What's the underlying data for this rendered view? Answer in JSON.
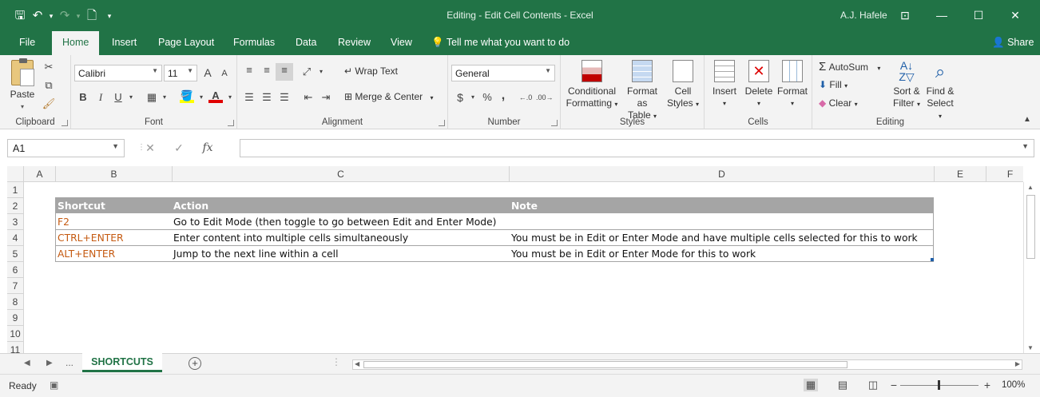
{
  "window": {
    "title": "Editing - Edit Cell Contents  -  Excel",
    "user": "A.J. Hafele",
    "qat": {
      "save": "🖫",
      "undo": "↶",
      "undo_drop": "▾",
      "redo": "↷",
      "redo_drop": "▾",
      "preview": "🗋",
      "customize": "▾"
    },
    "controls": {
      "ribbon_options": "⊡",
      "minimize": "—",
      "maximize": "☐",
      "close": "✕"
    }
  },
  "tabs": [
    {
      "label": "File"
    },
    {
      "label": "Home"
    },
    {
      "label": "Insert"
    },
    {
      "label": "Page Layout"
    },
    {
      "label": "Formulas"
    },
    {
      "label": "Data"
    },
    {
      "label": "Review"
    },
    {
      "label": "View"
    }
  ],
  "tell_me": "Tell me what you want to do",
  "share": "Share",
  "ribbon": {
    "clipboard": {
      "label": "Clipboard",
      "paste": "Paste"
    },
    "font": {
      "label": "Font",
      "family": "Calibri",
      "size": "11",
      "bold": "B",
      "italic": "I",
      "underline": "U",
      "grow": "A",
      "shrink": "A"
    },
    "alignment": {
      "label": "Alignment",
      "wrap": "Wrap Text",
      "merge": "Merge & Center"
    },
    "number": {
      "label": "Number",
      "format": "General",
      "currency": "$",
      "percent": "%",
      "comma": ","
    },
    "styles": {
      "label": "Styles",
      "conditional_1": "Conditional",
      "conditional_2": "Formatting",
      "table_1": "Format as",
      "table_2": "Table",
      "cell_1": "Cell",
      "cell_2": "Styles"
    },
    "cells": {
      "label": "Cells",
      "insert": "Insert",
      "delete": "Delete",
      "format": "Format"
    },
    "editing": {
      "label": "Editing",
      "autosum": "AutoSum",
      "fill": "Fill",
      "clear": "Clear",
      "sort_1": "Sort &",
      "sort_2": "Filter",
      "find_1": "Find &",
      "find_2": "Select"
    }
  },
  "formula_bar": {
    "name_box": "A1",
    "value": ""
  },
  "columns": [
    "A",
    "B",
    "C",
    "D",
    "E",
    "F"
  ],
  "rows": [
    "1",
    "2",
    "3",
    "4",
    "5",
    "6",
    "7",
    "8",
    "9",
    "10",
    "11"
  ],
  "table": {
    "headers": [
      "Shortcut",
      "Action",
      "Note"
    ],
    "rows": [
      {
        "shortcut": "F2",
        "action": "Go to Edit Mode (then toggle to go between Edit and Enter Mode)",
        "note": ""
      },
      {
        "shortcut": "CTRL+ENTER",
        "action": "Enter content into multiple cells simultaneously",
        "note": "You must be in Edit or Enter Mode and have multiple cells selected for this to work"
      },
      {
        "shortcut": "ALT+ENTER",
        "action": "Jump to the next line within a cell",
        "note": "You must be in Edit or Enter Mode for this to work"
      }
    ]
  },
  "sheets": {
    "ellipsis": "...",
    "active": "SHORTCUTS"
  },
  "status": {
    "ready": "Ready",
    "zoom": "100%"
  },
  "colors": {
    "brand": "#217346",
    "table_header": "#a5a5a5",
    "shortcut_text": "#c55a11"
  }
}
